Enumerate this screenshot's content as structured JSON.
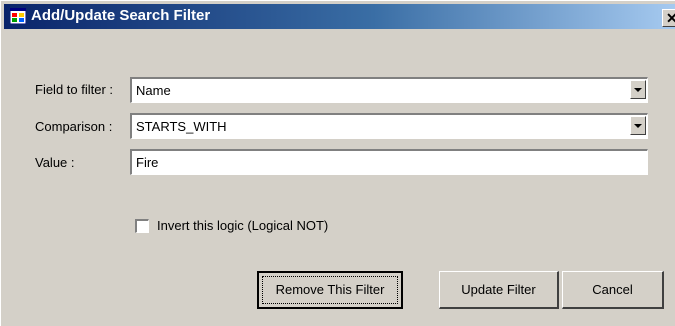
{
  "window": {
    "title": "Add/Update Search Filter",
    "icon": "app-window-icon",
    "close_glyph": "✕"
  },
  "form": {
    "field_label": "Field to filter :",
    "field_value": "Name",
    "comparison_label": "Comparison :",
    "comparison_value": "STARTS_WITH",
    "value_label": "Value :",
    "value_value": "Fire",
    "invert_label": "Invert this logic (Logical NOT)",
    "invert_checked": false
  },
  "buttons": {
    "remove": "Remove This Filter",
    "update": "Update Filter",
    "cancel": "Cancel"
  },
  "colors": {
    "face": "#d4d0c8",
    "title_start": "#0a246a",
    "title_end": "#a6caf0"
  }
}
